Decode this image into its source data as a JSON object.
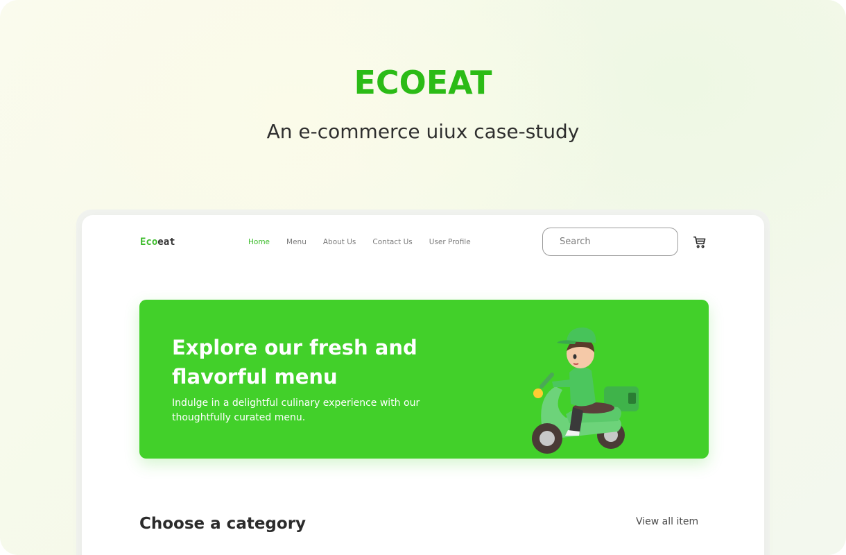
{
  "hero": {
    "title": "ECOEAT",
    "subtitle": "An e-commerce uiux case-study"
  },
  "mockup": {
    "logo": {
      "part1": "Eco",
      "part2": "eat"
    },
    "nav": [
      {
        "label": "Home",
        "active": true
      },
      {
        "label": "Menu",
        "active": false
      },
      {
        "label": "About Us",
        "active": false
      },
      {
        "label": "Contact Us",
        "active": false
      },
      {
        "label": "User Profile",
        "active": false
      }
    ],
    "search": {
      "placeholder": "Search",
      "value": ""
    },
    "cart_icon": "cart-icon",
    "banner": {
      "heading": "Explore our fresh and flavorful menu",
      "text": "Indulge in a delightful culinary experience with our thoughtfully curated menu.",
      "illustration": "delivery-rider-scooter"
    },
    "category": {
      "title": "Choose a category",
      "view_all": "View all item"
    }
  },
  "colors": {
    "brand_green": "#2bbb16",
    "banner_green": "#42d02a",
    "text_dark": "#2b2b2b"
  }
}
